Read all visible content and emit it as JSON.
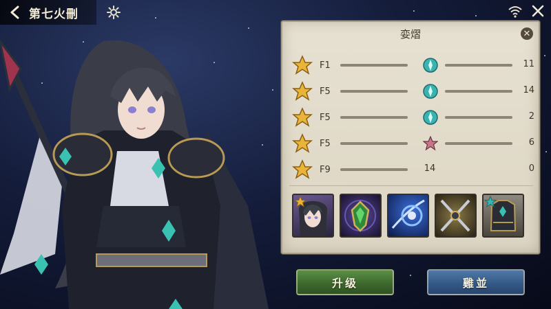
{
  "header": {
    "title": "第七火刪"
  },
  "panel": {
    "title": "娈熠",
    "stats": [
      {
        "label": "F1",
        "mid_icon": "teal-gem-icon",
        "mid_text": "",
        "right_value": "11"
      },
      {
        "label": "F5",
        "mid_icon": "teal-gem-icon",
        "mid_text": "",
        "right_value": "14"
      },
      {
        "label": "F5",
        "mid_icon": "teal-gem-icon",
        "mid_text": "",
        "right_value": "2"
      },
      {
        "label": "F5",
        "mid_icon": "pink-star-icon",
        "mid_text": "",
        "right_value": "6"
      },
      {
        "label": "F9",
        "mid_icon": "",
        "mid_text": "14",
        "right_value": "0"
      }
    ],
    "equipment": [
      {
        "name": "hero-portrait",
        "badge": "gold-star"
      },
      {
        "name": "green-amulet"
      },
      {
        "name": "blue-magic-orb"
      },
      {
        "name": "crossed-swords"
      },
      {
        "name": "armor-chest",
        "badge": "teal-star"
      }
    ]
  },
  "buttons": {
    "upgrade": "升级",
    "other": "雞並"
  },
  "colors": {
    "upgrade_btn": "#3e6a2e",
    "other_btn": "#355a87",
    "panel_bg": "#e2dccb",
    "gold": "#e8b53a",
    "teal": "#3bb3b0"
  }
}
